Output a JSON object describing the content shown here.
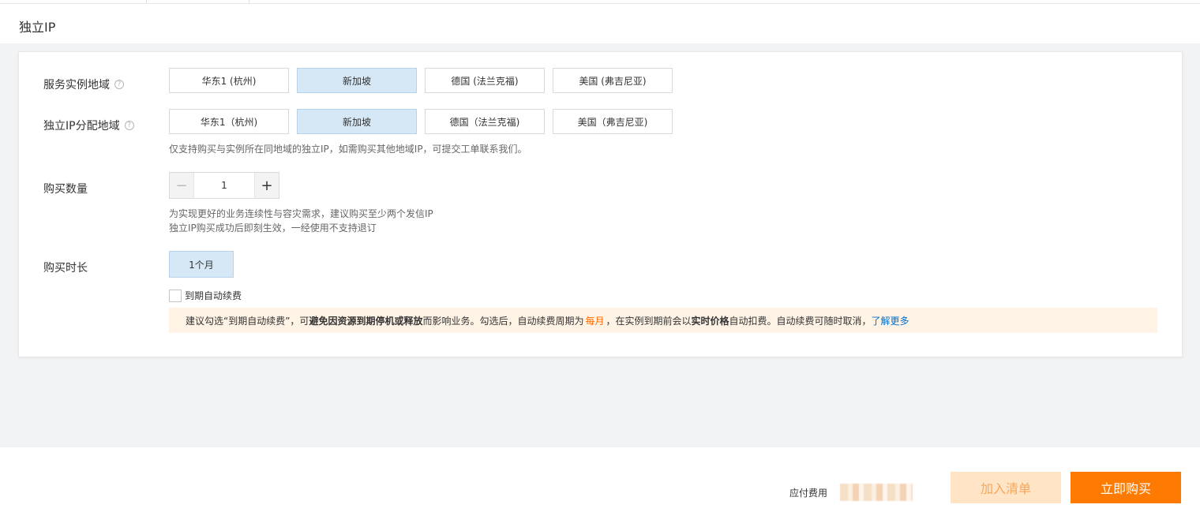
{
  "header": {
    "title": "独立IP"
  },
  "service_region": {
    "label": "服务实例地域",
    "options": [
      "华东1 (杭州)",
      "新加坡",
      "德国 (法兰克福)",
      "美国 (弗吉尼亚)"
    ],
    "selected": "新加坡"
  },
  "ip_region": {
    "label": "独立IP分配地域",
    "options": [
      "华东1（杭州)",
      "新加坡",
      "德国（法兰克福)",
      "美国（弗吉尼亚)"
    ],
    "selected": "新加坡",
    "hint": "仅支持购买与实例所在同地域的独立IP，如需购买其他地域IP，可提交工单联系我们。"
  },
  "quantity": {
    "label": "购买数量",
    "value": "1",
    "minus_symbol": "−",
    "plus_symbol": "+",
    "hint_line1": "为实现更好的业务连续性与容灾需求，建议购买至少两个发信IP",
    "hint_line2": "独立IP购买成功后即刻生效，一经使用不支持退订"
  },
  "duration": {
    "label": "购买时长",
    "selected": "1个月"
  },
  "auto_renew": {
    "label": "到期自动续费",
    "checked": false
  },
  "notice": {
    "part1": "建议勾选“到期自动续费”，可",
    "bold1": "避免因资源到期停机或释放",
    "part2": "而影响业务。勾选后，自动续费周期为",
    "period": "每月",
    "part3": "，在实例到期前会以",
    "bold2": "实时价格",
    "part4": "自动扣费。自动续费可随时取消，",
    "link": "了解更多"
  },
  "footer": {
    "price_label": "应付费用",
    "add_cart": "加入清单",
    "buy_now": "立即购买"
  },
  "colors": {
    "selected_bg": "#d6e8f6",
    "accent_orange": "#ff7a00",
    "link_blue": "#0070cc",
    "notice_bg": "#fff3e6"
  }
}
